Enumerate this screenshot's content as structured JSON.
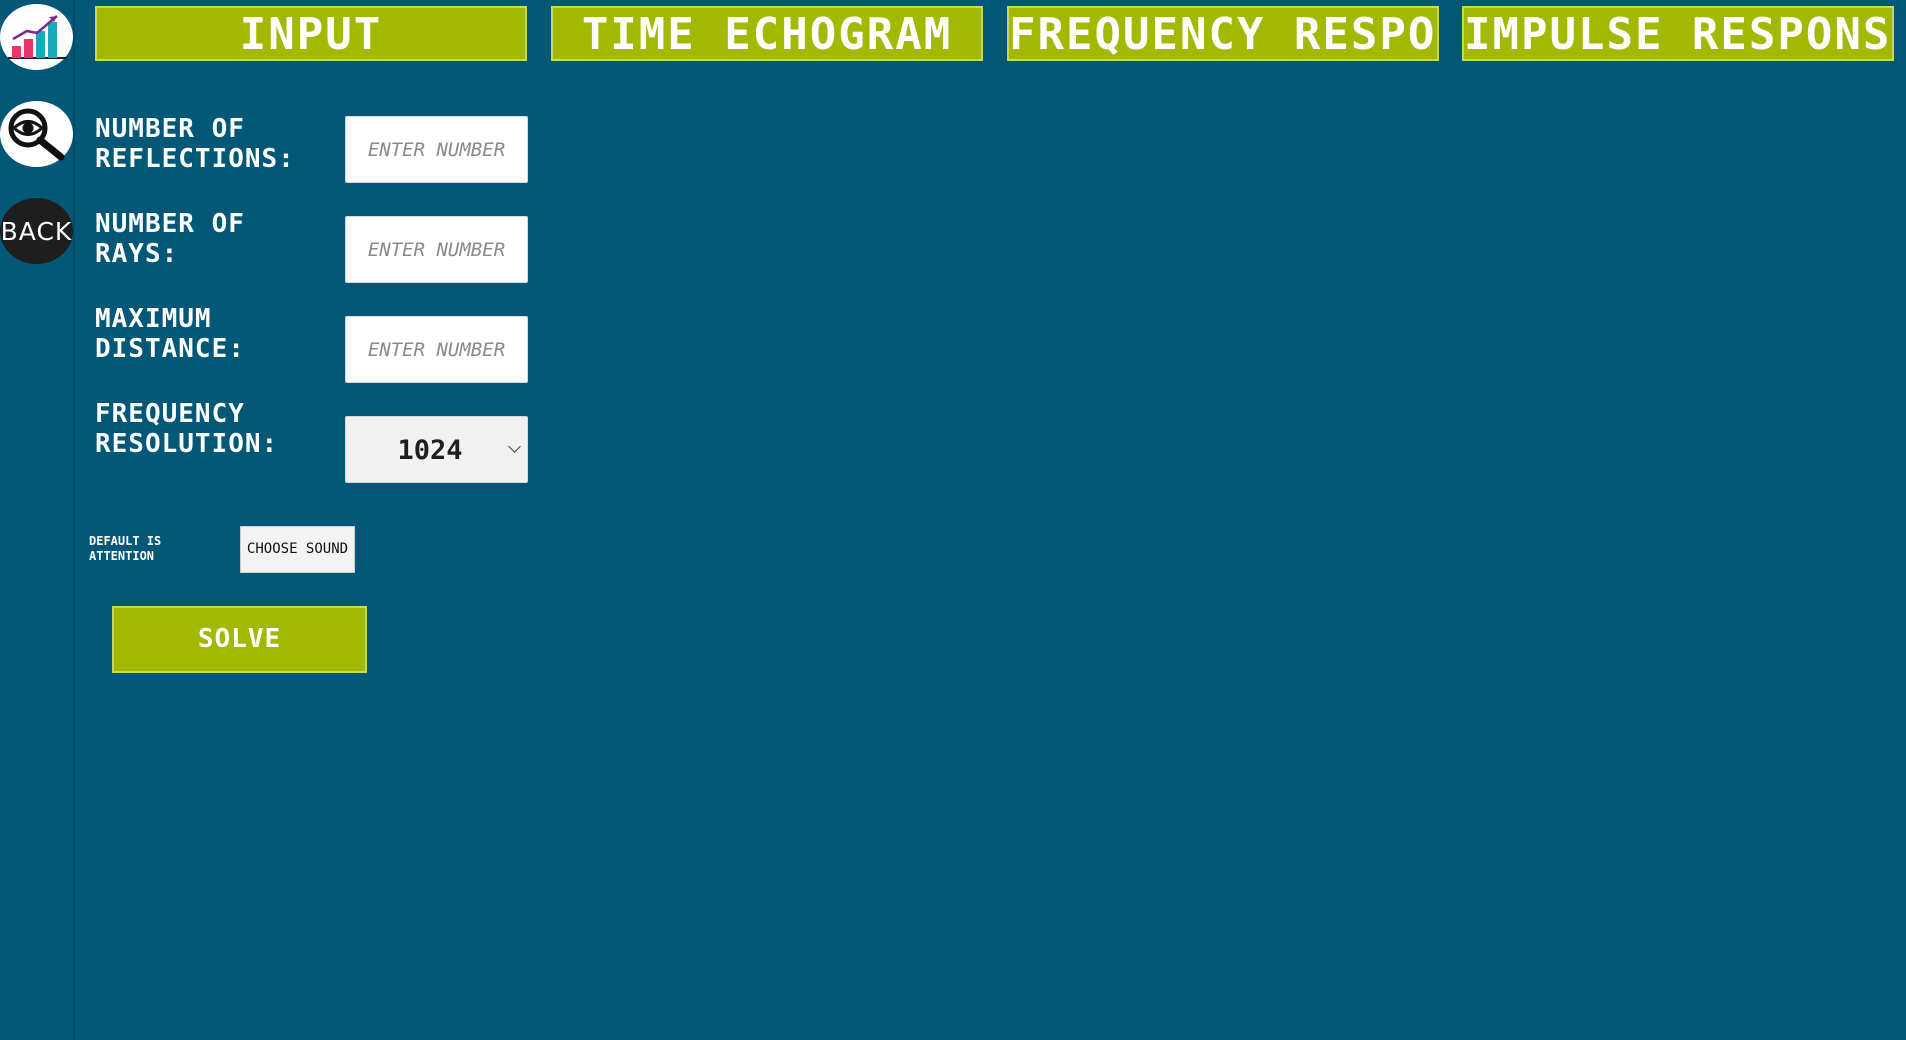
{
  "sidebar": {
    "items": [
      {
        "name": "chart",
        "icon": "bar-chart-icon"
      },
      {
        "name": "search",
        "icon": "eye-magnifier-icon"
      },
      {
        "name": "back",
        "label": "BACK"
      }
    ]
  },
  "tabs": [
    {
      "label": "INPUT"
    },
    {
      "label": "TIME ECHOGRAM"
    },
    {
      "label": "FREQUENCY RESPONSE"
    },
    {
      "label": "IMPULSE RESPONSE"
    }
  ],
  "form": {
    "reflections": {
      "label": "NUMBER OF\nREFLECTIONS:",
      "placeholder": "ENTER NUMBER",
      "value": ""
    },
    "rays": {
      "label": "NUMBER OF\nRAYS:",
      "placeholder": "ENTER NUMBER",
      "value": ""
    },
    "distance": {
      "label": "MAXIMUM\nDISTANCE:",
      "placeholder": "ENTER NUMBER",
      "value": ""
    },
    "resolution": {
      "label": "FREQUENCY\nRESOLUTION:",
      "selected": "1024"
    }
  },
  "sound": {
    "note": "DEFAULT IS\nATTENTION",
    "button_label": "CHOOSE SOUND"
  },
  "solve_label": "SOLVE",
  "colors": {
    "background": "#035777",
    "accent": "#a2b801",
    "text": "#ffffff"
  }
}
